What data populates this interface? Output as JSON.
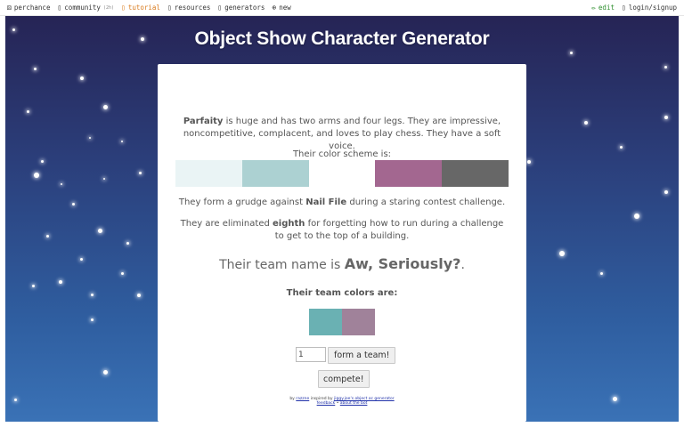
{
  "topbar": {
    "left": [
      {
        "icon": "dice-icon",
        "glyph": "⚄",
        "label": "perchance"
      },
      {
        "icon": "chat-icon",
        "glyph": "▯",
        "label": "community",
        "badge": "(2h)"
      },
      {
        "icon": "info-icon",
        "glyph": "▯",
        "label": "tutorial"
      },
      {
        "icon": "book-icon",
        "glyph": "▯",
        "label": "resources"
      },
      {
        "icon": "grid-icon",
        "glyph": "▯",
        "label": "generators"
      },
      {
        "icon": "plus-circle-icon",
        "glyph": "⊕",
        "label": "new"
      }
    ],
    "right": [
      {
        "icon": "pencil-icon",
        "glyph": "✏",
        "label": "edit"
      },
      {
        "icon": "user-icon",
        "glyph": "▯",
        "label": "login/signup"
      }
    ]
  },
  "page": {
    "title": "Object Show Character Generator"
  },
  "character": {
    "name": "Parfaity",
    "description": "is huge and has two arms and four legs. They are impressive, noncompetitive, complacent, and loves to play chess. They have a soft voice.",
    "scheme_label": "Their color scheme is:",
    "scheme_colors": [
      "#eaf4f5",
      "#acd1d2",
      "#ffffff",
      "#a36790",
      "#676767"
    ],
    "grudge_prefix": "They form a grudge against",
    "grudge_target": "Nail File",
    "grudge_suffix": "during a staring contest challenge.",
    "elim_prefix": "They are eliminated",
    "elim_place": "eighth",
    "elim_suffix": "for forgetting how to run during a challenge to get to the top of a building.",
    "team_prefix": "Their team name is",
    "team_name": "Aw, Seriously?",
    "team_suffix": ".",
    "team_colors_label": "Their team colors are:",
    "team_colors": [
      "#6ab1b3",
      "#a0829a"
    ]
  },
  "form": {
    "team_count_value": "1",
    "form_team_label": "form a team!",
    "compete_label": "compete!"
  },
  "footer": {
    "by": "by",
    "author": "razzne",
    "inspired": "inspired by",
    "inspired_link": "jiggy.joe's object oc generator",
    "feedback": "feedback",
    "about": "about the bot"
  }
}
